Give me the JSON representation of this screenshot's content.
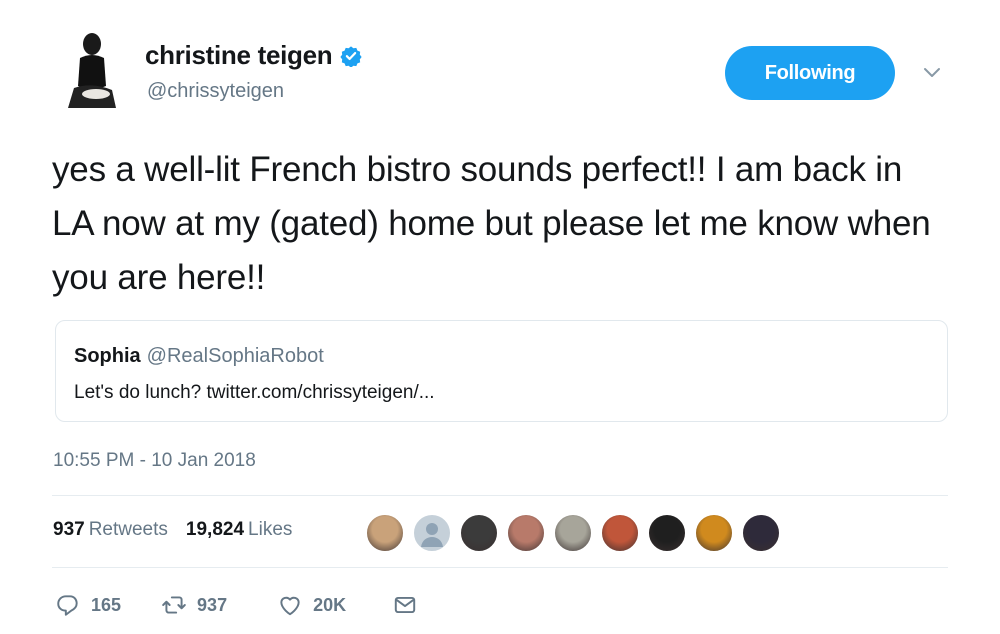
{
  "author": {
    "name": "christine teigen",
    "handle": "@chrissyteigen",
    "verified_icon": "verified-badge-icon",
    "avatar_icon": "profile-photo"
  },
  "follow_button": {
    "label": "Following"
  },
  "menu_icon": "chevron-down-icon",
  "tweet": {
    "text": "yes a well-lit French bistro sounds perfect!! I am back in LA now at my (gated) home but please let me know when you are here!!"
  },
  "quoted_tweet": {
    "name": "Sophia",
    "handle": "@RealSophiaRobot",
    "text": "Let's do lunch? twitter.com/chrissyteigen/..."
  },
  "timestamp": "10:55 PM - 10 Jan 2018",
  "stats": {
    "retweets_count": "937",
    "retweets_label": "Retweets",
    "likes_count": "19,824",
    "likes_label": "Likes"
  },
  "likers": [
    {
      "icon": "user-avatar",
      "color": "#c9a27a"
    },
    {
      "icon": "default-avatar",
      "color": "#8fa3b5"
    },
    {
      "icon": "user-avatar",
      "color": "#3b3b3b"
    },
    {
      "icon": "user-avatar",
      "color": "#b87a6a"
    },
    {
      "icon": "user-avatar",
      "color": "#a7a59a"
    },
    {
      "icon": "user-avatar",
      "color": "#c0563a"
    },
    {
      "icon": "user-avatar",
      "color": "#1f1f1f"
    },
    {
      "icon": "user-avatar",
      "color": "#d08a1e"
    },
    {
      "icon": "user-avatar",
      "color": "#2e2a3a"
    }
  ],
  "actions": {
    "reply_count": "165",
    "retweet_count": "937",
    "like_count": "20K"
  },
  "colors": {
    "accent": "#1da1f2",
    "secondary_text": "#657786",
    "border": "#e1e8ed"
  }
}
